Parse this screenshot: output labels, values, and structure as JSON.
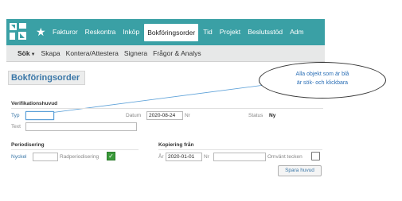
{
  "nav": {
    "items": [
      {
        "label": "Fakturor"
      },
      {
        "label": "Reskontra"
      },
      {
        "label": "Inköp"
      },
      {
        "label": "Bokföringsorder",
        "active": true
      },
      {
        "label": "Tid"
      },
      {
        "label": "Projekt"
      },
      {
        "label": "Beslutsstöd"
      },
      {
        "label": "Adm"
      }
    ]
  },
  "subnav": {
    "items": [
      {
        "label": "Sök"
      },
      {
        "label": "Skapa"
      },
      {
        "label": "Kontera/Attestera"
      },
      {
        "label": "Signera"
      },
      {
        "label": "Frågor & Analys"
      }
    ]
  },
  "page": {
    "title": "Bokföringsorder"
  },
  "callout": {
    "line1": "Alla objekt som är blå",
    "line2": "är sök- och klickbara"
  },
  "verifikation": {
    "title": "Verifikationshuvud",
    "typ_label": "Typ",
    "typ_value": "",
    "datum_label": "Datum",
    "datum_value": "2020-08-24",
    "nr_label": "Nr",
    "status_label": "Status",
    "status_value": "Ny",
    "text_label": "Text"
  },
  "periodisering": {
    "title": "Periodisering",
    "nyckel_label": "Nyckel",
    "radperiodisering_label": "Radperiodisering",
    "radperiodisering_checked": true
  },
  "kopiering": {
    "title": "Kopiering från",
    "ar_label": "År",
    "ar_value": "2020-01-01",
    "nr_label": "Nr",
    "omvant_label": "Omvänt tecken",
    "omvant_checked": false,
    "save_label": "Spara huvud"
  },
  "colors": {
    "nav_bg": "#3aa0a5",
    "link_blue": "#3c78a8",
    "check_green": "#3a9a3a",
    "callout_text": "#2b6fb6"
  }
}
